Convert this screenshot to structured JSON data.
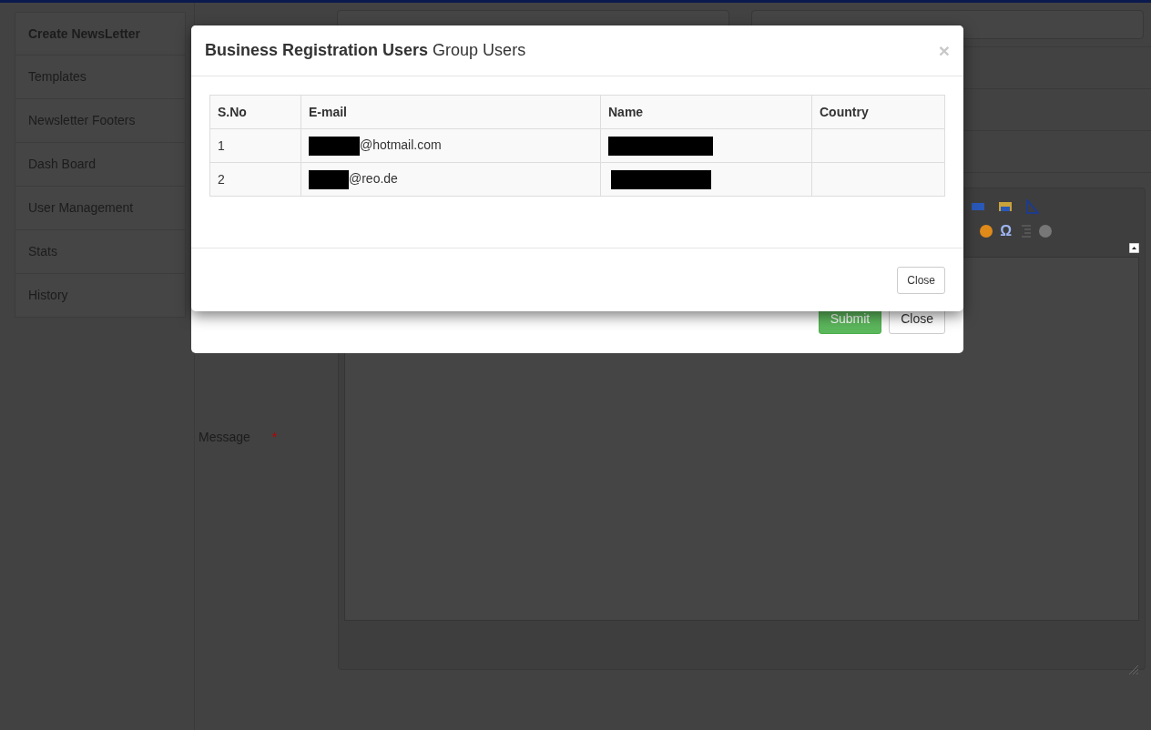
{
  "sidebar": {
    "items": [
      {
        "label": "Create NewsLetter",
        "selected": true
      },
      {
        "label": "Templates",
        "selected": false
      },
      {
        "label": "Newsletter Footers",
        "selected": false
      },
      {
        "label": "Dash Board",
        "selected": false
      },
      {
        "label": "User Management",
        "selected": false
      },
      {
        "label": "Stats",
        "selected": false
      },
      {
        "label": "History",
        "selected": false
      }
    ]
  },
  "form": {
    "message_label": "Message",
    "required_mark": "*",
    "editor_symbol": "Ω"
  },
  "back_modal": {
    "buttons": [
      {
        "label": "Submit",
        "kind": "primary"
      },
      {
        "label": "Close",
        "kind": "default"
      }
    ]
  },
  "modal": {
    "title": "**Business Registration Users** Group Users",
    "close_symbol": "×",
    "table": {
      "columns": [
        "S.No",
        "E-mail",
        "Name",
        "Country"
      ],
      "rows": [
        {
          "s_no": "1",
          "email": "@hotmail.com",
          "email_redacted": true,
          "name_redacted": true
        },
        {
          "s_no": "2",
          "email": "@reo.de",
          "email_redacted": true,
          "name_redacted": true
        }
      ]
    },
    "footer_button": "Close"
  }
}
